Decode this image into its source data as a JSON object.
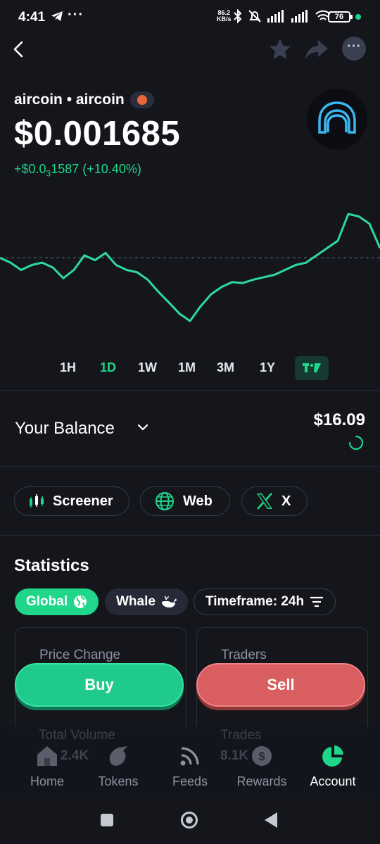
{
  "status_bar": {
    "time": "4:41",
    "more_dots": "···",
    "speed_value": "86.2",
    "speed_unit": "KB/s",
    "battery": "76"
  },
  "token": {
    "name_line": "aircoin • aircoin",
    "price": "$0.001685",
    "change_prefix": "+$0.0",
    "change_sub": "3",
    "change_suffix": "1587 (+10.40%)"
  },
  "chart_data": {
    "type": "line",
    "series_color": "#2ed9a0",
    "reference_line": "dashed",
    "values": [
      0.00157,
      0.00156,
      0.001545,
      0.001555,
      0.00156,
      0.00155,
      0.001528,
      0.001545,
      0.001575,
      0.001565,
      0.00158,
      0.001555,
      0.001545,
      0.00154,
      0.001525,
      0.0015,
      0.001478,
      0.001455,
      0.00144,
      0.00147,
      0.001495,
      0.00151,
      0.00152,
      0.001518,
      0.001525,
      0.00153,
      0.001535,
      0.001545,
      0.001555,
      0.00156,
      0.001575,
      0.00159,
      0.001605,
      0.00166,
      0.001655,
      0.00164,
      0.00159
    ],
    "trend": "up"
  },
  "ranges": [
    "1H",
    "1D",
    "1W",
    "1M",
    "3M",
    "1Y"
  ],
  "active_range": "1D",
  "balance": {
    "label": "Your Balance",
    "value": "$16.09"
  },
  "links": [
    {
      "label": "Screener",
      "icon": "screener-icon"
    },
    {
      "label": "Web",
      "icon": "globe-icon"
    },
    {
      "label": "X",
      "icon": "x-logo-icon"
    }
  ],
  "statistics": {
    "title": "Statistics",
    "filters": {
      "global": "Global",
      "whale": "Whale",
      "timeframe": "Timeframe: 24h"
    },
    "cards": [
      {
        "label": "Price Change"
      },
      {
        "label": "Traders"
      },
      {
        "label": "Total Volume",
        "value": "2.4K"
      },
      {
        "label": "Trades",
        "value": "8.1K"
      }
    ]
  },
  "actions": {
    "buy": "Buy",
    "sell": "Sell"
  },
  "bottom_nav": [
    {
      "label": "Home",
      "icon": "home-icon"
    },
    {
      "label": "Tokens",
      "icon": "tokens-icon"
    },
    {
      "label": "Feeds",
      "icon": "rss-icon"
    },
    {
      "label": "Rewards",
      "icon": "rewards-icon"
    },
    {
      "label": "Account",
      "icon": "pie-chart-icon",
      "active": true
    }
  ],
  "colors": {
    "background": "#14161c",
    "accent_green": "#1fd68a",
    "sell_red": "#d85e60"
  }
}
